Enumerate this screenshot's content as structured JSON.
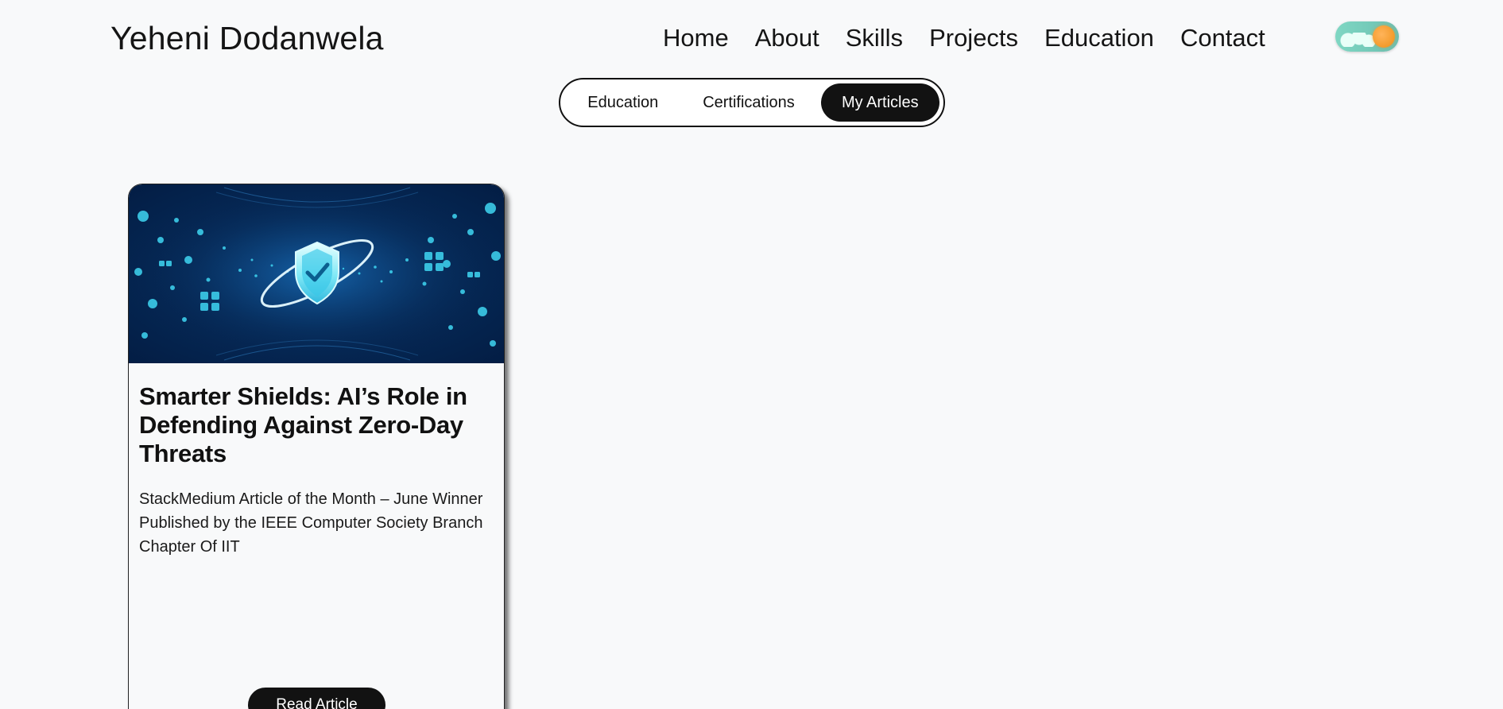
{
  "header": {
    "brand": "Yeheni Dodanwela",
    "nav": [
      "Home",
      "About",
      "Skills",
      "Projects",
      "Education",
      "Contact"
    ],
    "theme_toggle": {
      "icon": "sun-cloud-icon",
      "mode": "light"
    }
  },
  "tabs": {
    "items": [
      "Education",
      "Certifications",
      "My Articles"
    ],
    "active": "My Articles"
  },
  "articles": [
    {
      "image_icon": "shield-check-icon",
      "title": "Smarter Shields: AI’s Role in Defending Against Zero-Day Threats",
      "lines": [
        "StackMedium Article of the Month – June Winner",
        "Published by the IEEE Computer Society Branch Chapter Of IIT"
      ],
      "button_label": "Read Article"
    }
  ],
  "colors": {
    "background": "#f8f9fa",
    "text": "#111111",
    "active_tab": "#121212",
    "button": "#121212",
    "image_bg": "#062a58",
    "image_accent": "#33d1f0",
    "toggle_sun": "#f39a2a",
    "toggle_track": "#7fd7c3"
  }
}
